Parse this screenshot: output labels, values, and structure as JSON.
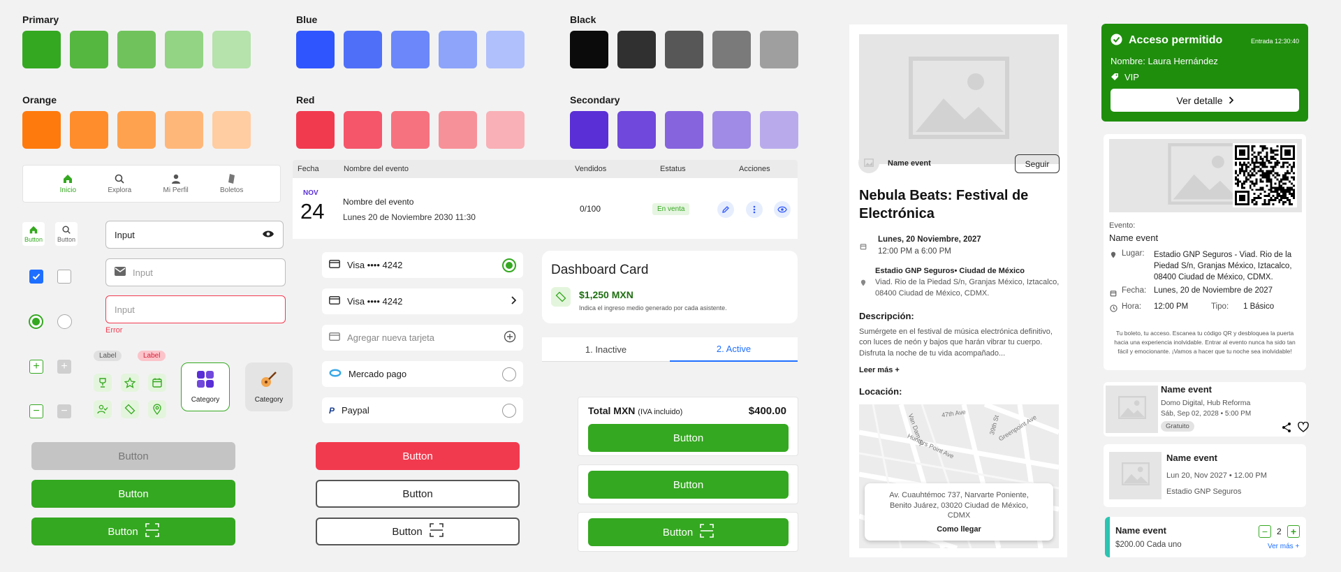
{
  "palette": {
    "primary": {
      "label": "Primary",
      "colors": [
        "#34a820",
        "#55b73f",
        "#70c35c",
        "#93d384",
        "#b5e3ab"
      ]
    },
    "blue": {
      "label": "Blue",
      "colors": [
        "#2f55ff",
        "#4f6ff8",
        "#6b87f9",
        "#8ea4fa",
        "#b0c0fc"
      ]
    },
    "black": {
      "label": "Black",
      "colors": [
        "#0b0b0b",
        "#303030",
        "#575757",
        "#7a7a7a",
        "#9f9f9f"
      ]
    },
    "orange": {
      "label": "Orange",
      "colors": [
        "#ff7a0c",
        "#ff8d2c",
        "#ffa24f",
        "#ffb779",
        "#ffcda1"
      ]
    },
    "red": {
      "label": "Red",
      "colors": [
        "#f23a4e",
        "#f5566a",
        "#f6727f",
        "#f79199",
        "#f9b0b6"
      ]
    },
    "secondary": {
      "label": "Secondary",
      "colors": [
        "#5a2fd6",
        "#7048db",
        "#8664de",
        "#a08be6",
        "#b9abeb"
      ]
    }
  },
  "nav": {
    "items": [
      "Inicio",
      "Explora",
      "Mi Perfil",
      "Boletos"
    ]
  },
  "mini_buttons": {
    "home": "Button",
    "search": "Button"
  },
  "inputs": {
    "one": "Input",
    "two_placeholder": "Input",
    "three_placeholder": "Input",
    "error": "Error"
  },
  "tags": {
    "label1": "Label",
    "label2": "Label"
  },
  "category": {
    "one": "Category",
    "two": "Category"
  },
  "buttons": {
    "disabled": "Button",
    "primary": "Button",
    "scan": "Button"
  },
  "table": {
    "headers": [
      "Fecha",
      "Nombre del evento",
      "Vendidos",
      "Estatus",
      "Acciones"
    ],
    "row": {
      "month": "NOV",
      "day": "24",
      "title": "Nombre del evento",
      "date": "Lunes 20 de Noviembre 2030  11:30",
      "sold": "0/100",
      "status": "En venta"
    }
  },
  "payments": [
    "Visa •••• 4242",
    "Visa •••• 4242",
    "Agregar nueva tarjeta",
    "Mercado pago",
    "Paypal"
  ],
  "red_buttons": {
    "red": "Button",
    "outline": "Button",
    "outline_scan": "Button"
  },
  "dashboard": {
    "title": "Dashboard Card",
    "amount": "$1,250 MXN",
    "caption": "Indica el ingreso medio generado por cada asistente."
  },
  "steps": {
    "one": "1. Inactive",
    "two": "2. Active"
  },
  "total": {
    "label": "Total MXN",
    "note": "(IVA incluido)",
    "amount": "$400.00",
    "btn1": "Button",
    "btn2": "Button",
    "btn3": "Button"
  },
  "event": {
    "organizer": "Name event",
    "follow": "Seguir",
    "title": "Nebula Beats: Festival de Electrónica",
    "date": "Lunes, 20 Noviembre, 2027",
    "time": "12:00 PM a 6:00 PM",
    "venue": "Estadio GNP Seguros• Ciudad de México",
    "address": "Viad. Rio de la Piedad S/n, Granjas México, Iztacalco, 08400 Ciudad de México, CDMX.",
    "desc_label": "Descripción:",
    "desc": "Sumérgete en el festival de música electrónica definitivo, con luces de neón y bajos que harán vibrar tu cuerpo. Disfruta la noche de tu vida acompañado...",
    "more": "Leer más +",
    "loc_label": "Locación:",
    "map_streets": [
      "47th Ave",
      "Van Dam St",
      "Hunters Point Ave",
      "Greenpoint Ave",
      "39th St"
    ],
    "map_address": "Av. Cuauhtémoc 737, Narvarte Poniente, Benito Juárez, 03020 Ciudad de México, CDMX",
    "directions": "Como llegar"
  },
  "access": {
    "title": "Acceso permitido",
    "entry": "Entrada 12:30:40",
    "name": "Nombre: Laura Hernández",
    "tier": "VIP",
    "detail": "Ver detalle"
  },
  "ticket": {
    "event_label": "Evento:",
    "event_name": "Name event",
    "place_label": "Lugar:",
    "place": "Estadio GNP Seguros - Viad. Rio de la Piedad S/n, Granjas México, Iztacalco, 08400 Ciudad de México, CDMX.",
    "date_label": "Fecha:",
    "date": "Lunes, 20 de Noviembre de 2027",
    "hour_label": "Hora:",
    "hour": "12:00 PM",
    "type_label": "Tipo:",
    "type": "1 Básico",
    "note": "Tu boleto, tu acceso. Escanea tu código QR y desbloquea la puerta hacia una experiencia inolvidable. Entrar al evento nunca ha sido tan fácil y emocionante. ¡Vamos a hacer que tu noche sea inolvidable!"
  },
  "list1": {
    "name": "Name event",
    "place": "Domo Digital, Hub Reforma",
    "date": "Sáb, Sep 02, 2028 • 5:00 PM",
    "badge": "Gratuito"
  },
  "list2": {
    "name": "Name event",
    "date": "Lun 20, Nov 2027 • 12.00 PM",
    "place": "Estadio GNP Seguros"
  },
  "qty": {
    "name": "Name event",
    "price": "$200.00 Cada uno",
    "count": "2",
    "more": "Ver más +"
  }
}
